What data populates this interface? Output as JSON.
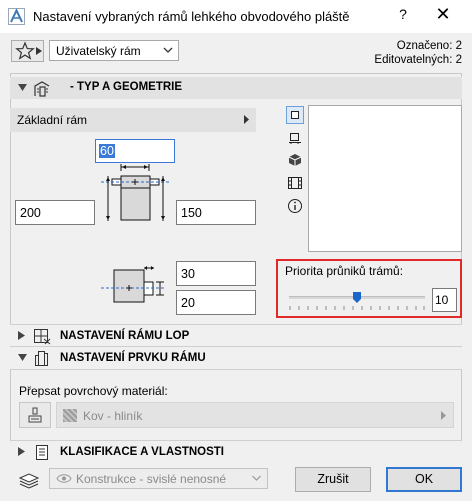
{
  "window": {
    "title": "Nastavení vybraných rámů lehkého obvodového pláště",
    "help_glyph": "?",
    "close_glyph": "✕"
  },
  "top": {
    "preset_value": "Uživatelský rám",
    "selected_label": "Označeno: 2",
    "editable_label": "Editovatelných: 2"
  },
  "sections": {
    "type_geometry": "- TYP A GEOMETRIE",
    "lop_frame": "NASTAVENÍ RÁMU LOP",
    "frame_element": "NASTAVENÍ PRVKU RÁMU",
    "classification": "KLASIFIKACE A VLASTNOSTI"
  },
  "geometry": {
    "frame_type": "Základní rám",
    "width": "60",
    "offset_left": "200",
    "offset_right": "150",
    "cap_width": "30",
    "cap_depth": "20"
  },
  "priority": {
    "label": "Priorita průniků trámů:",
    "value": "10",
    "fraction": 0.5
  },
  "material": {
    "label": "Přepsat povrchový materiál:",
    "value": "Kov - hliník"
  },
  "bottom": {
    "layer_value": "Konstrukce - svislé nenosné",
    "cancel_label": "Zrušit",
    "ok_label": "OK"
  }
}
